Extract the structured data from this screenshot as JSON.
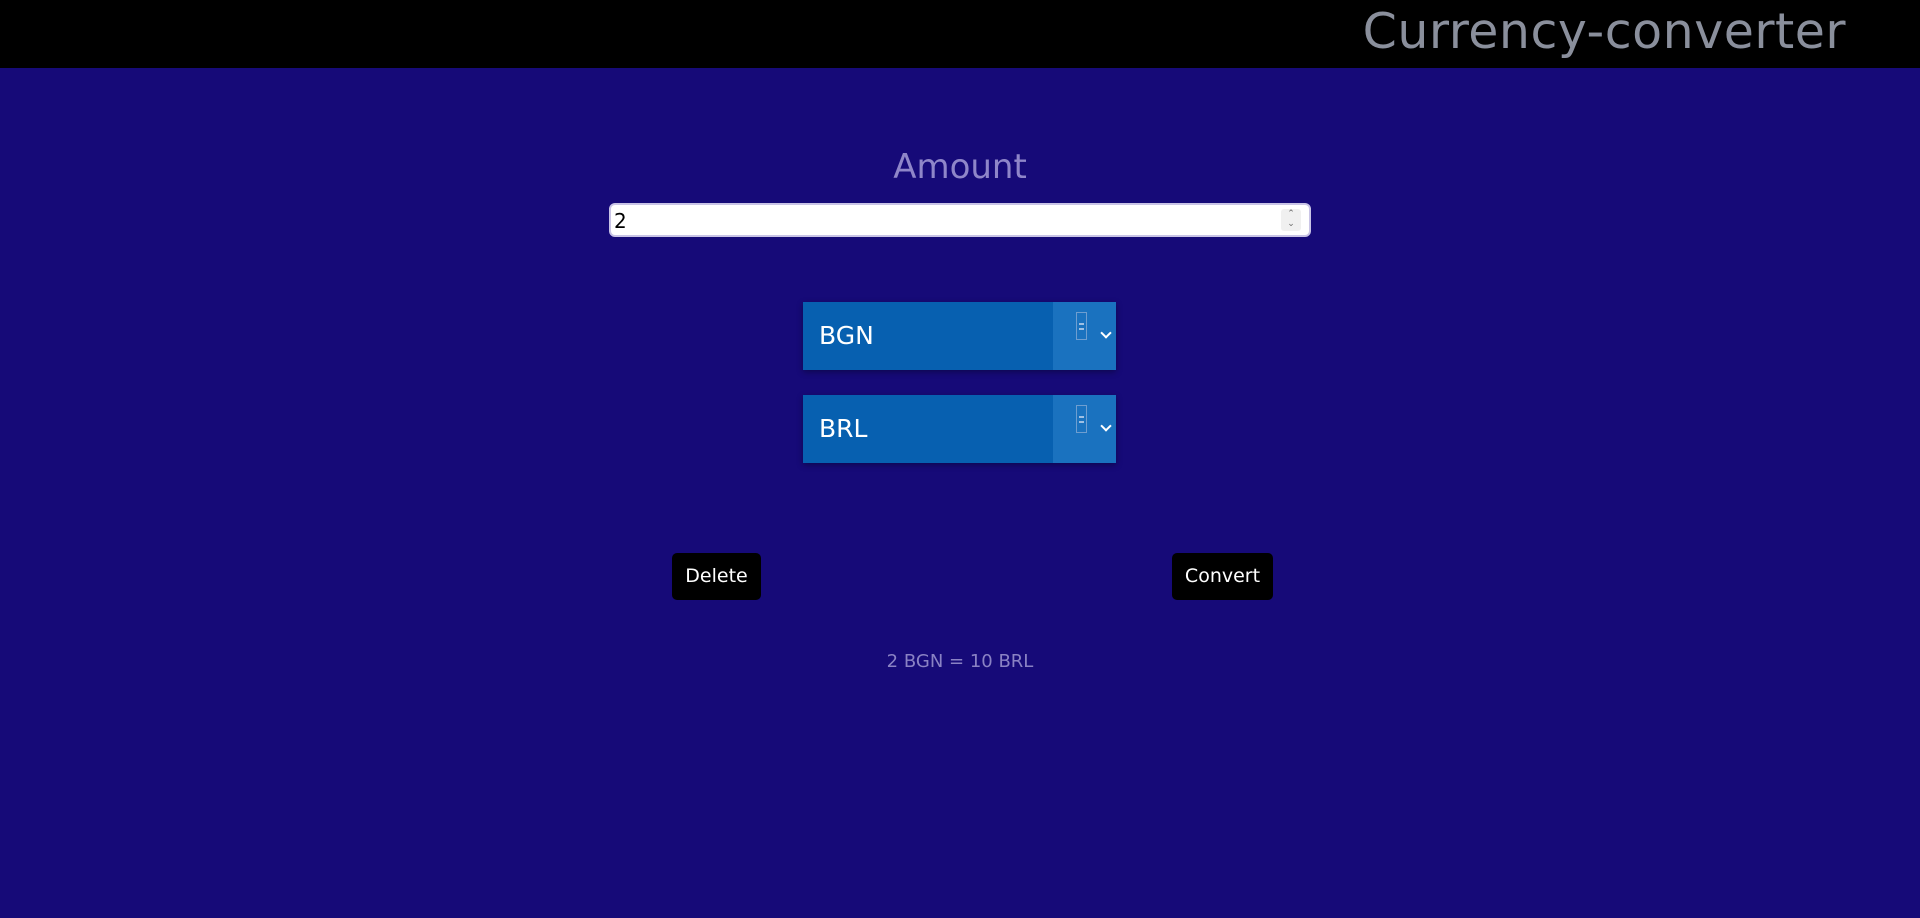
{
  "header": {
    "title": "Currency-converter"
  },
  "amount": {
    "label": "Amount",
    "value": "2"
  },
  "from_currency": {
    "selected": "BGN"
  },
  "to_currency": {
    "selected": "BRL"
  },
  "actions": {
    "delete_label": "Delete",
    "convert_label": "Convert"
  },
  "result": {
    "text": "2 BGN = 10 BRL"
  },
  "colors": {
    "background": "#160a78",
    "topbar": "#000000",
    "select_bg": "#0760b0",
    "button_bg": "#000000"
  },
  "icons": [
    "keyboard-icon",
    "chevron-down-icon",
    "spinner-arrows-icon"
  ]
}
